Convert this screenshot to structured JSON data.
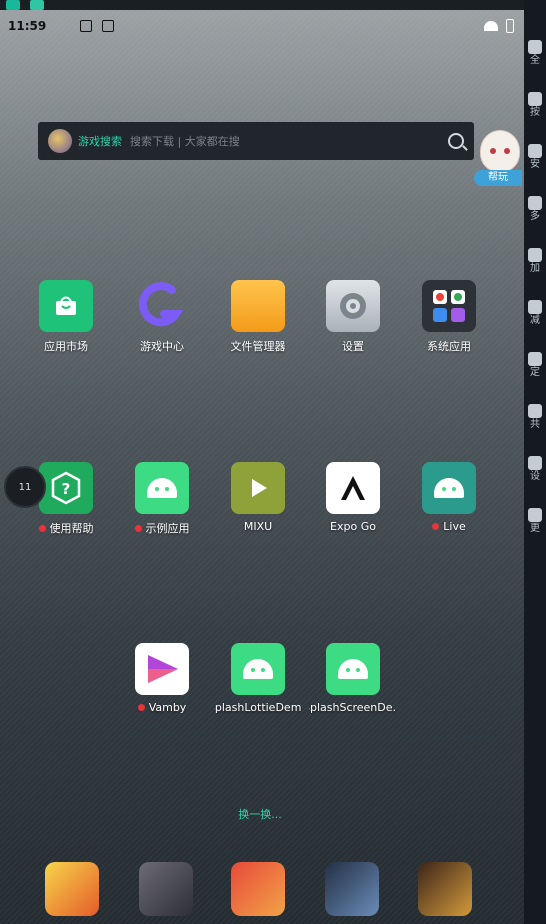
{
  "status": {
    "time": "11:59"
  },
  "search": {
    "tag": "游戏搜索",
    "placeholder": "搜索下载 | 大家都在搜"
  },
  "mascot": {
    "badge": "帮玩"
  },
  "apps_row1": [
    {
      "label": "应用市场",
      "icon": "store-icon"
    },
    {
      "label": "游戏中心",
      "icon": "game-icon"
    },
    {
      "label": "文件管理器",
      "icon": "file-manager-icon"
    },
    {
      "label": "设置",
      "icon": "settings-icon"
    },
    {
      "label": "系统应用",
      "icon": "folder-icon"
    }
  ],
  "apps_row2": [
    {
      "label": "使用帮助",
      "icon": "help-icon",
      "dot": true
    },
    {
      "label": "示例应用",
      "icon": "android-icon",
      "dot": true
    },
    {
      "label": "MIXU",
      "icon": "play-icon",
      "dot": false
    },
    {
      "label": "Expo Go",
      "icon": "expo-icon",
      "dot": false
    },
    {
      "label": "Live",
      "icon": "android-icon",
      "dot": true
    }
  ],
  "apps_row3": [
    {
      "label": "Vamby",
      "icon": "vamby-icon",
      "dot": true
    },
    {
      "label": "SplashLottieDemo",
      "icon": "android-icon",
      "dot": false
    },
    {
      "label": "SplashScreenDe...",
      "icon": "android-icon",
      "dot": false
    }
  ],
  "swap": "换一换...",
  "fps": "11",
  "sidebar": [
    "全",
    "按",
    "安",
    "多",
    "加",
    "减",
    "定",
    "共",
    "设",
    "更"
  ]
}
